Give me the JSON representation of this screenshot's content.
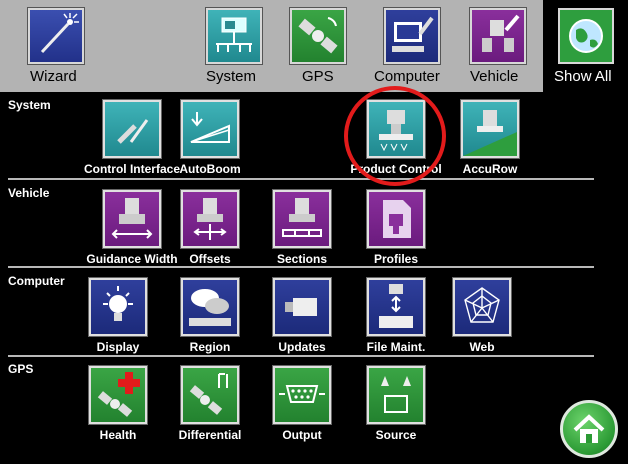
{
  "top_categories": [
    {
      "label": "Wizard",
      "icon": "wand-icon"
    },
    {
      "label": "System",
      "icon": "console-icon"
    },
    {
      "label": "GPS",
      "icon": "satellite-icon"
    },
    {
      "label": "Computer",
      "icon": "computer-icon"
    },
    {
      "label": "Vehicle",
      "icon": "vehicle-wrench-icon"
    }
  ],
  "show_all": {
    "label": "Show All",
    "icon": "globe-icon"
  },
  "sections": {
    "system": {
      "title": "System",
      "items": [
        {
          "label": "Control Interface",
          "icon": "wrench-screwdriver-icon"
        },
        {
          "label": "AutoBoom",
          "icon": "boom-icon"
        },
        {
          "label": "Product Control",
          "icon": "product-control-icon"
        },
        {
          "label": "AccuRow",
          "icon": "accurow-icon"
        }
      ]
    },
    "vehicle": {
      "title": "Vehicle",
      "items": [
        {
          "label": "Guidance Width",
          "icon": "guidance-width-icon"
        },
        {
          "label": "Offsets",
          "icon": "offsets-icon"
        },
        {
          "label": "Sections",
          "icon": "sections-icon"
        },
        {
          "label": "Profiles",
          "icon": "profiles-icon"
        }
      ]
    },
    "computer": {
      "title": "Computer",
      "items": [
        {
          "label": "Display",
          "icon": "lightbulb-icon"
        },
        {
          "label": "Region",
          "icon": "region-icon"
        },
        {
          "label": "Updates",
          "icon": "usb-icon"
        },
        {
          "label": "File Maint.",
          "icon": "file-transfer-icon"
        },
        {
          "label": "Web",
          "icon": "web-icon"
        }
      ]
    },
    "gps": {
      "title": "GPS",
      "items": [
        {
          "label": "Health",
          "icon": "satellite-health-icon"
        },
        {
          "label": "Differential",
          "icon": "differential-icon"
        },
        {
          "label": "Output",
          "icon": "serial-port-icon"
        },
        {
          "label": "Source",
          "icon": "source-icon"
        }
      ]
    }
  },
  "highlight_color": "#e21b1b",
  "home": {
    "icon": "home-icon"
  }
}
